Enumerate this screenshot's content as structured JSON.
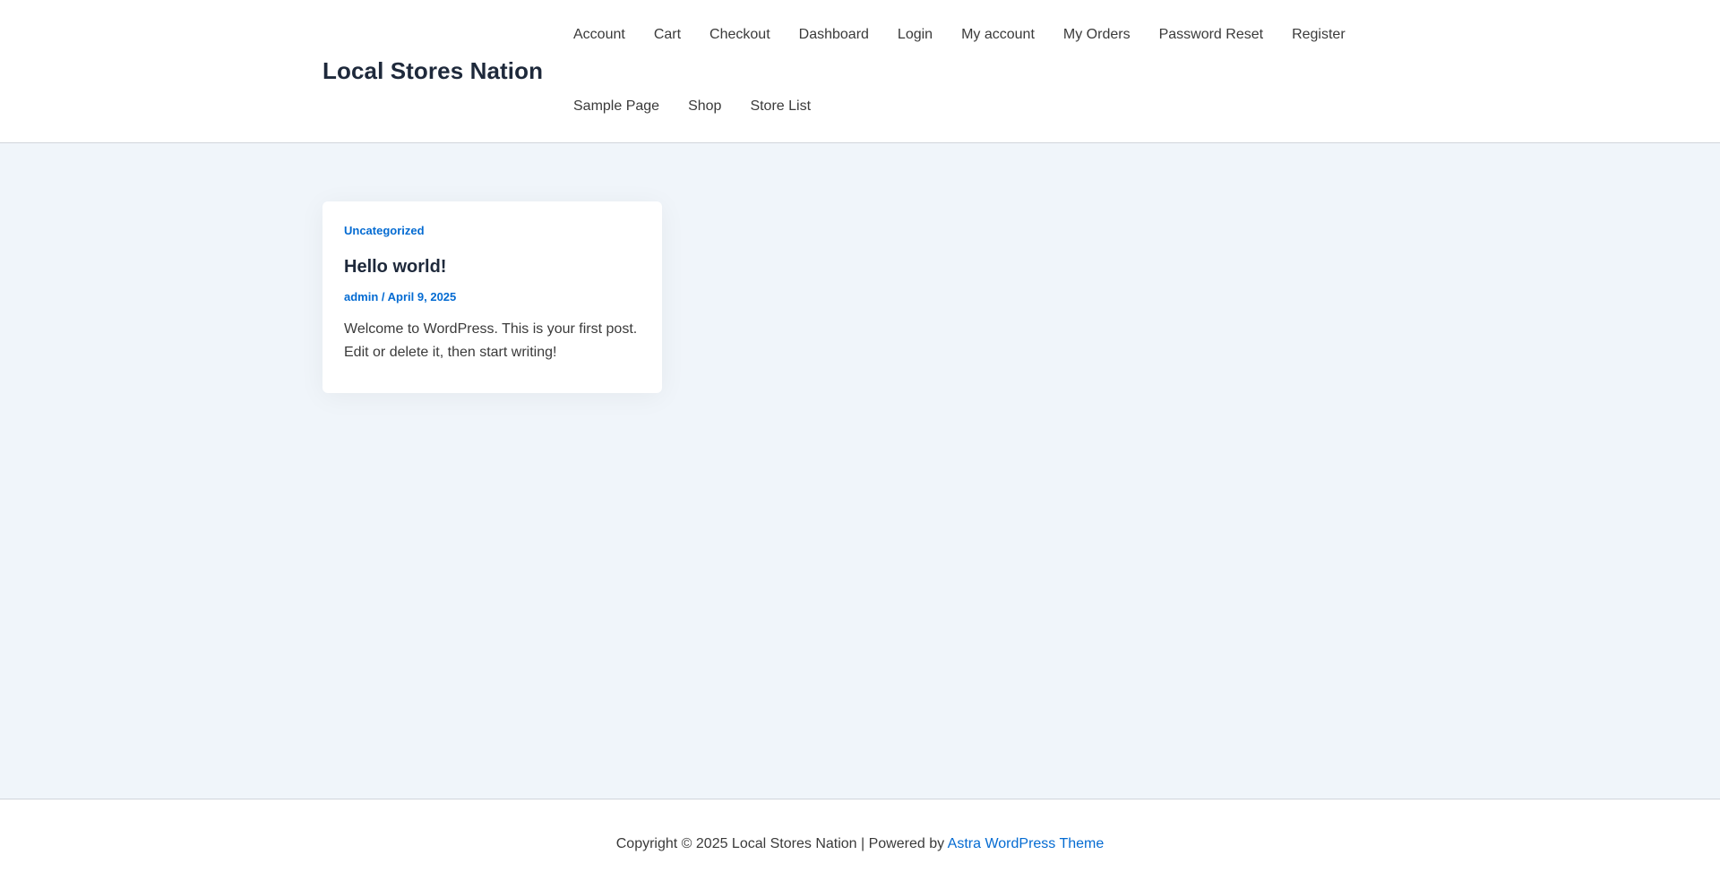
{
  "header": {
    "site_title": "Local Stores Nation",
    "nav_row_1": [
      "Account",
      "Cart",
      "Checkout",
      "Dashboard",
      "Login",
      "My account",
      "My Orders",
      "Password Reset",
      "Register"
    ],
    "nav_row_2": [
      "Sample Page",
      "Shop",
      "Store List"
    ]
  },
  "post": {
    "category": "Uncategorized",
    "title": "Hello world!",
    "author": "admin",
    "meta_separator": " / ",
    "date": "April 9, 2025",
    "excerpt_line_1": "Welcome to WordPress. This is your first post.",
    "excerpt_line_2": "Edit or delete it, then start writing!"
  },
  "footer": {
    "copyright": "Copyright © 2025 Local Stores Nation | Powered by ",
    "theme_link": "Astra WordPress Theme"
  },
  "colors": {
    "accent": "#046bd2",
    "heading": "#1e293b",
    "body_text": "#3a3a3a",
    "page_background": "#f0f5fa",
    "surface": "#ffffff"
  }
}
